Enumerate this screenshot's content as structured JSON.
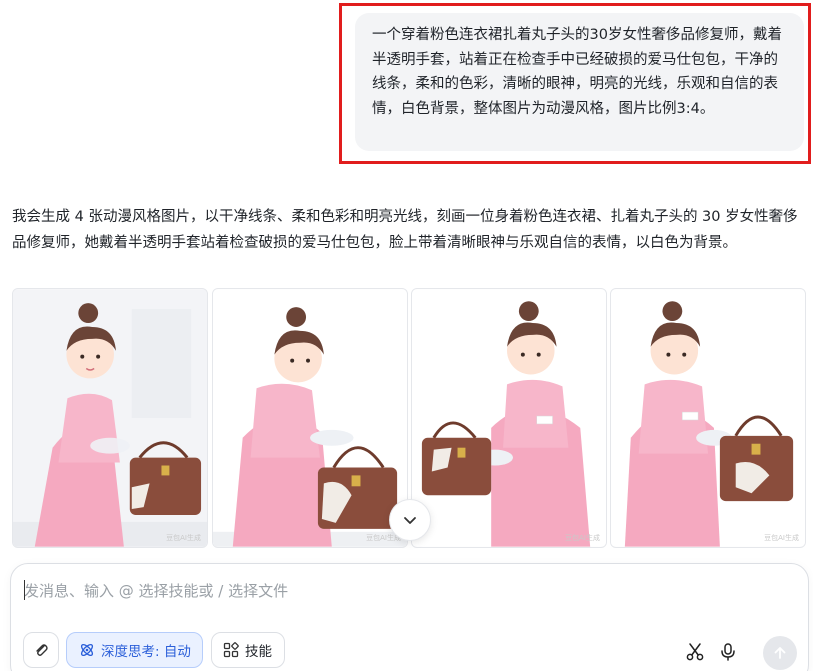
{
  "user_message": {
    "text": "一个穿着粉色连衣裙扎着丸子头的30岁女性奢侈品修复师，戴着半透明手套，站着正在检查手中已经破损的爱马仕包包，干净的线条，柔和的色彩，清晰的眼神，明亮的光线，乐观和自信的表情，白色背景，整体图片为动漫风格，图片比例3:4。"
  },
  "assistant": {
    "text": "我会生成 4 张动漫风格图片，以干净线条、柔和色彩和明亮光线，刻画一位身着粉色连衣裙、扎着丸子头的 30 岁女性奢侈品修复师，她戴着半透明手套站着检查破损的爱马仕包包，脸上带着清晰眼神与乐观自信的表情，以白色为背景。"
  },
  "images": [
    {
      "watermark": "豆包AI生成"
    },
    {
      "watermark": "豆包AI生成"
    },
    {
      "watermark": "豆包AI生成"
    },
    {
      "watermark": "豆包AI生成"
    }
  ],
  "composer": {
    "placeholder": "发消息、输入 @ 选择技能或 / 选择文件",
    "value": "",
    "deep_think_label": "深度思考: 自动",
    "skills_label": "技能"
  },
  "icons": {
    "scroll_down": "chevron-down-icon",
    "attach": "paperclip-icon",
    "deep_think": "atom-icon",
    "skills": "grid-icon",
    "scissors": "scissors-icon",
    "mic": "microphone-icon",
    "send": "arrow-up-icon"
  },
  "colors": {
    "highlight_frame": "#e11d1d",
    "accent": "#2b5fd9",
    "dress": "#f5a9c0",
    "bag": "#8a4d3c"
  }
}
